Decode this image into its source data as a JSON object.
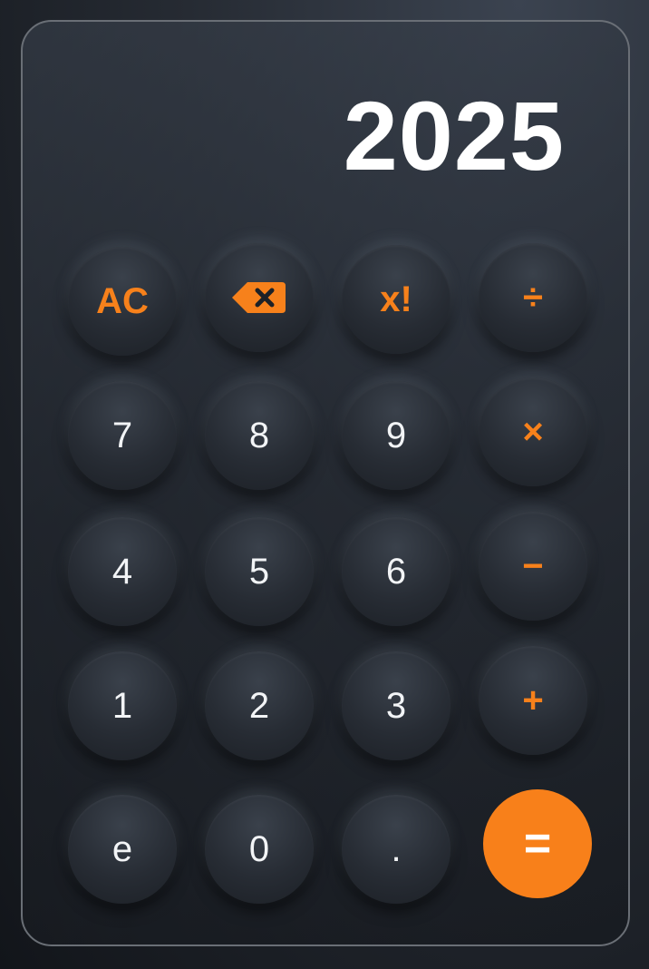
{
  "display": {
    "value": "2025"
  },
  "keys": {
    "ac": "AC",
    "backspace_icon": "backspace-icon",
    "factorial": "x!",
    "divide": "÷",
    "seven": "7",
    "eight": "8",
    "nine": "9",
    "multiply": "×",
    "four": "4",
    "five": "5",
    "six": "6",
    "subtract": "−",
    "one": "1",
    "two": "2",
    "three": "3",
    "add": "+",
    "euler": "e",
    "zero": "0",
    "decimal": ".",
    "equals": "="
  },
  "colors": {
    "accent": "#f7811b",
    "key_text": "#f2f4f6",
    "display_text": "#ffffff"
  }
}
